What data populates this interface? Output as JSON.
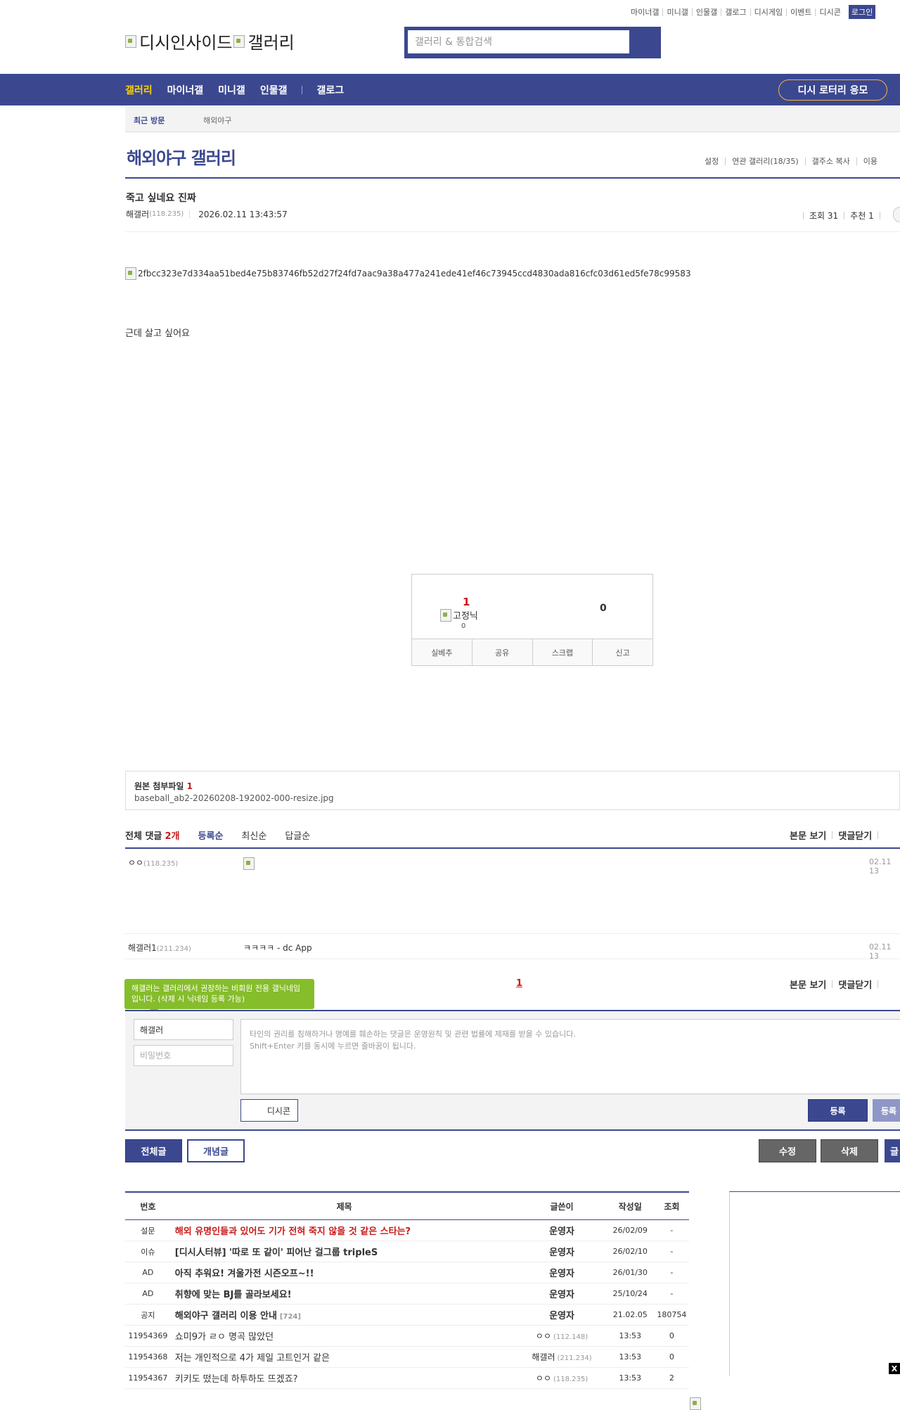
{
  "header": {
    "util_links": [
      "마이너갤",
      "미니갤",
      "인물갤",
      "갤로그",
      "디시게임",
      "이벤트",
      "디시콘"
    ],
    "login": "로그인",
    "logo_text_1": "디시인사이드",
    "logo_text_2": "갤러리",
    "search_placeholder": "갤러리 & 통합검색"
  },
  "gnb": {
    "items": [
      "갤러리",
      "마이너갤",
      "미니갤",
      "인물갤",
      "갤로그"
    ],
    "lotto": "디시 로터리 응모"
  },
  "visit": {
    "label": "최근 방문",
    "items": [
      "해외야구"
    ]
  },
  "gallery": {
    "title": "해외야구 갤러리",
    "options": [
      "설정",
      "연관 갤러리(18/35)",
      "갤주소 복사",
      "이용"
    ]
  },
  "post": {
    "title": "죽고 싶네요 진짜",
    "author": "해갤러",
    "author_ip": "(118.235)",
    "date": "2026.02.11 13:43:57",
    "views": "조회 31",
    "recommend": "추천 1",
    "image_alt": "2fbcc323e7d334aa51bed4e75b83746fb52d27f24fd7aac9a38a477a241ede41ef46c73945ccd4830ada816cfc03d61ed5fe78c99583",
    "body": "근데 살고 싶어요"
  },
  "recommend_box": {
    "up": "1",
    "nick_img": "고정닉",
    "fixed_count": "0",
    "down": "0",
    "buttons": [
      "실베추",
      "공유",
      "스크랩",
      "신고"
    ]
  },
  "attachment": {
    "label": "원본 첨부파일",
    "count": "1",
    "file": "baseball_ab2-20260208-192002-000-resize.jpg"
  },
  "comments": {
    "total_label": "전체 댓글",
    "total_count": "2개",
    "sorts": [
      "등록순",
      "최신순",
      "답글순"
    ],
    "right": [
      "본문 보기",
      "댓글닫기"
    ],
    "items": [
      {
        "nick": "ㅇㅇ",
        "ip": "(118.235)",
        "text": "",
        "date": "02.11 13"
      },
      {
        "nick": "해갤러1",
        "ip": "(211.234)",
        "text": "ㅋㅋㅋㅋ - dc App",
        "date": "02.11 13"
      }
    ],
    "page": "1",
    "tip": "해갤러는 갤러리에서 권장하는 비회원 전용 갤닉네임입니다. (삭제 시 닉네임 등록 가능)"
  },
  "comment_form": {
    "nick_value": "해갤러",
    "pw_placeholder": "비밀번호",
    "textarea_placeholder": "타인의 권리를 침해하거나 명예를 훼손하는 댓글은 운영원칙 및 관련 법률에 제재를 받을 수 있습니다.\nShift+Enter 키를 동시에 누르면 줄바꿈이 됩니다.",
    "dccon": "디시콘",
    "submit": "등록",
    "submit2": "등록"
  },
  "actions": {
    "all": "전체글",
    "best": "개념글",
    "edit": "수정",
    "delete": "삭제",
    "write": "글"
  },
  "list": {
    "headers": [
      "번호",
      "제목",
      "글쓴이",
      "작성일",
      "조회"
    ],
    "rows": [
      {
        "no": "설문",
        "title": "해외 유명인들과 있어도 기가 전혀 죽지 않을 것 같은 스타는?",
        "writer": "운영자",
        "date": "26/02/09",
        "views": "-",
        "style": "red"
      },
      {
        "no": "이슈",
        "title": "[디시人터뷰] '따로 또 같이' 피어난 걸그룹 tripleS",
        "writer": "운영자",
        "date": "26/02/10",
        "views": "-",
        "style": "b"
      },
      {
        "no": "AD",
        "title": "아직 추워요! 겨울가전 시즌오프~!!",
        "writer": "운영자",
        "date": "26/01/30",
        "views": "-",
        "style": "b"
      },
      {
        "no": "AD",
        "title": "취향에 맞는 BJ를 골라보세요!",
        "writer": "운영자",
        "date": "25/10/24",
        "views": "-",
        "style": "b"
      },
      {
        "no": "공지",
        "title": "해외야구 갤러리 이용 안내",
        "count": "[724]",
        "writer": "운영자",
        "date": "21.02.05",
        "views": "180754",
        "style": "b"
      },
      {
        "no": "11954369",
        "title": "쇼미9가 ㄹㅇ 명곡 많았던",
        "writer": "ㅇㅇ",
        "ip": "(112.148)",
        "date": "13:53",
        "views": "0",
        "style": ""
      },
      {
        "no": "11954368",
        "title": "저는 개인적으로 4가 제일 고트인거 같은",
        "writer": "해갤러",
        "ip": "(211.234)",
        "date": "13:53",
        "views": "0",
        "style": ""
      },
      {
        "no": "11954367",
        "title": "키키도 떴는데 하투하도 뜨겠죠?",
        "writer": "ㅇㅇ",
        "ip": "(118.235)",
        "date": "13:53",
        "views": "2",
        "style": ""
      }
    ]
  }
}
